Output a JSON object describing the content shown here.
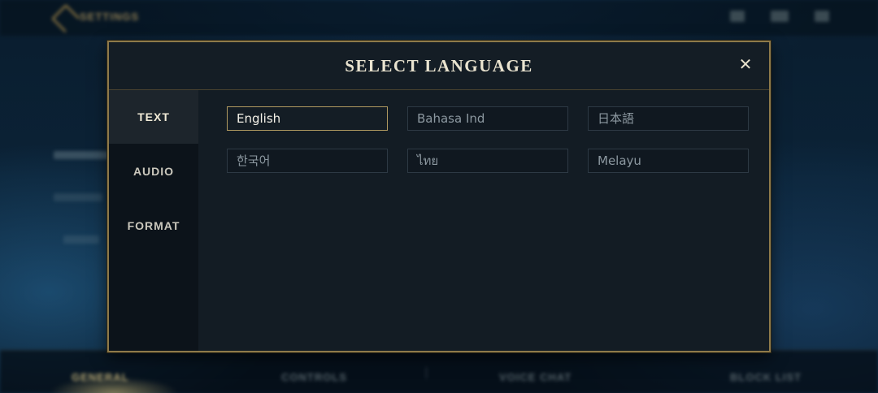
{
  "background": {
    "app_title": "SETTINGS",
    "bottom_tabs": [
      "GENERAL",
      "CONTROLS",
      "VOICE CHAT",
      "BLOCK LIST"
    ]
  },
  "dialog": {
    "title": "SELECT LANGUAGE",
    "close_label": "✕",
    "side_tabs": [
      {
        "label": "TEXT",
        "active": true
      },
      {
        "label": "AUDIO",
        "active": false
      },
      {
        "label": "FORMAT",
        "active": false
      }
    ],
    "languages": [
      {
        "label": "English",
        "selected": true
      },
      {
        "label": "Bahasa Ind",
        "selected": false
      },
      {
        "label": "日本語",
        "selected": false
      },
      {
        "label": "한국어",
        "selected": false
      },
      {
        "label": "ไทย",
        "selected": false
      },
      {
        "label": "Melayu",
        "selected": false
      }
    ]
  },
  "colors": {
    "accent_gold": "#a3915c",
    "panel_bg": "#111a22",
    "text_light": "#e9e3cf"
  }
}
